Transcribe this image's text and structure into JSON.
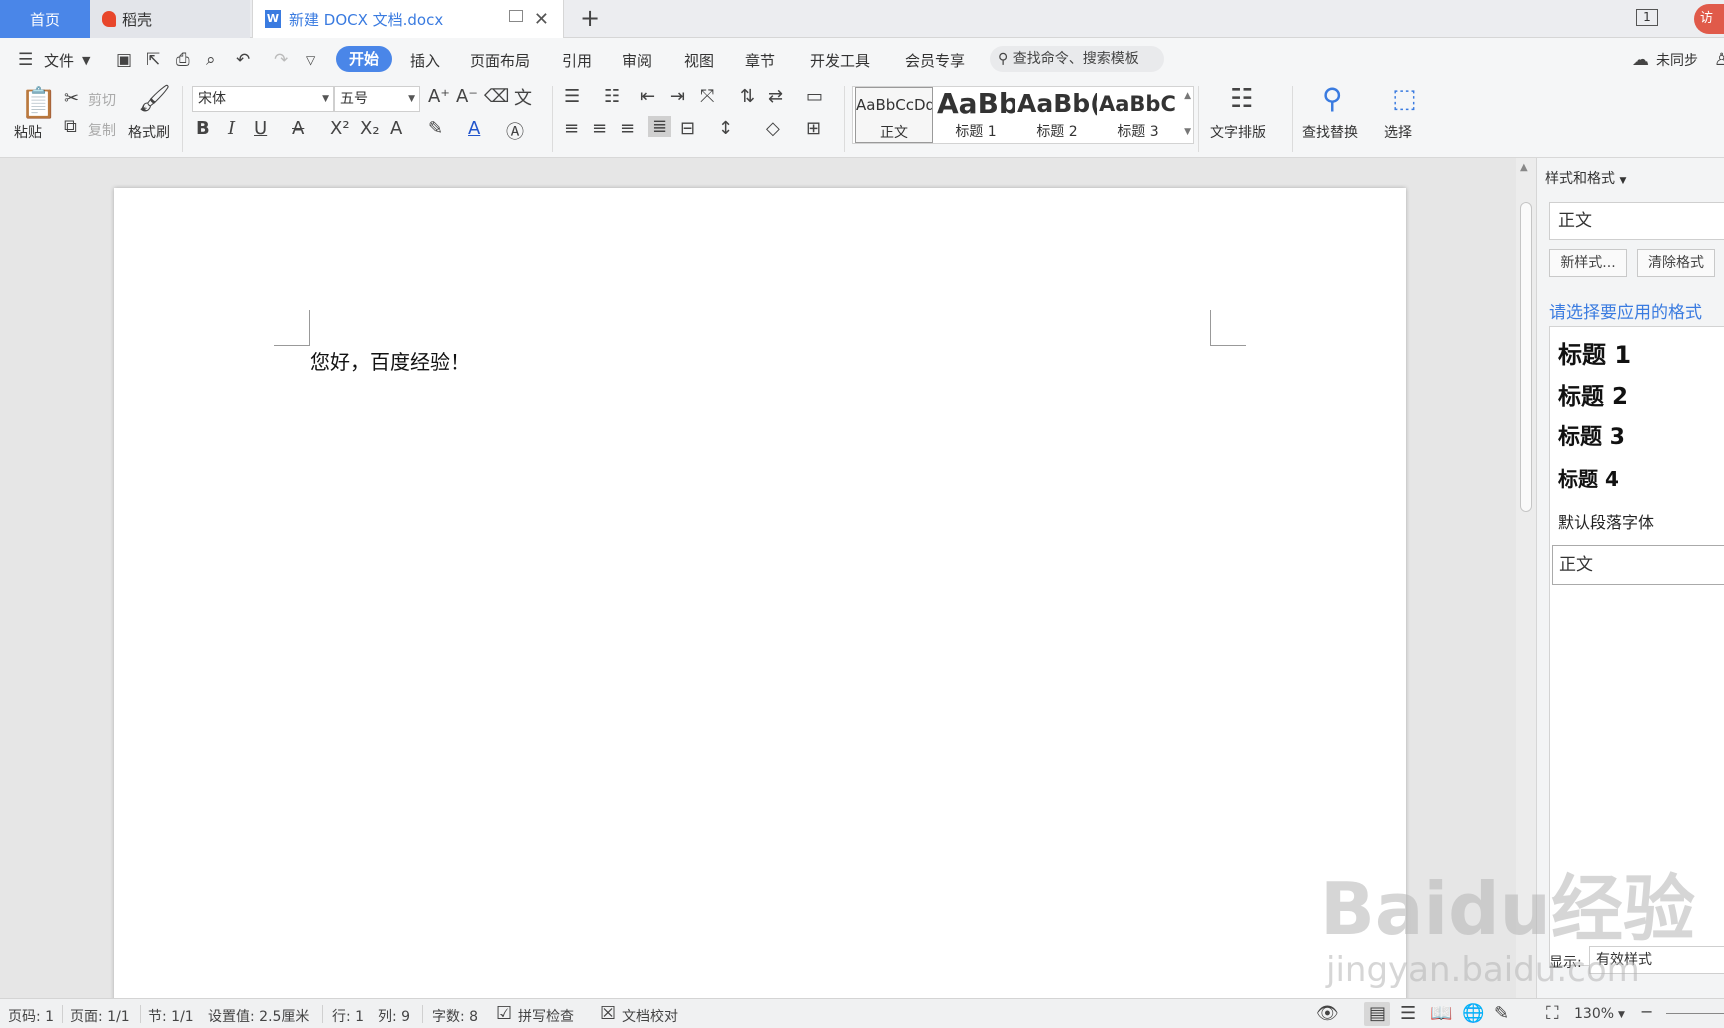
{
  "tabs": {
    "home": "首页",
    "daoke": "稻壳",
    "doc": "新建 DOCX 文档.docx",
    "window_count": "1",
    "user_badge": "访"
  },
  "menu": {
    "file": "文件",
    "items": [
      "开始",
      "插入",
      "页面布局",
      "引用",
      "审阅",
      "视图",
      "章节",
      "开发工具",
      "会员专享"
    ],
    "search_placeholder": "查找命令、搜索模板",
    "sync": "未同步"
  },
  "ribbon": {
    "paste": "粘贴",
    "cut": "剪切",
    "copy": "复制",
    "format_painter": "格式刷",
    "font_name": "宋体",
    "font_size": "五号",
    "styles": [
      {
        "preview": "AaBbCcDd",
        "name": "正文"
      },
      {
        "preview": "AaBb",
        "name": "标题 1"
      },
      {
        "preview": "AaBb(",
        "name": "标题 2"
      },
      {
        "preview": "AaBbC(",
        "name": "标题 3"
      }
    ],
    "text_layout": "文字排版",
    "find_replace": "查找替换",
    "select": "选择"
  },
  "document": {
    "text": "您好，百度经验！"
  },
  "pane": {
    "title": "样式和格式",
    "current_style": "正文",
    "new_style": "新样式...",
    "clear_format": "清除格式",
    "prompt": "请选择要应用的格式",
    "headings": [
      "标题 1",
      "标题 2",
      "标题 3",
      "标题 4"
    ],
    "default_font": "默认段落字体",
    "selected": "正文",
    "show_label": "显示:",
    "show_value": "有效样式"
  },
  "status": {
    "page_no": "页码: 1",
    "pages": "页面: 1/1",
    "section": "节: 1/1",
    "setting": "设置值: 2.5厘米",
    "line": "行: 1",
    "col": "列: 9",
    "words": "字数: 8",
    "spell": "拼写检查",
    "proof": "文档校对",
    "zoom": "130%"
  },
  "watermark": {
    "brand": "Baidu经验",
    "url": "jingyan.baidu.com"
  },
  "colors": {
    "accent": "#4a86e8",
    "link": "#3a7be0"
  }
}
